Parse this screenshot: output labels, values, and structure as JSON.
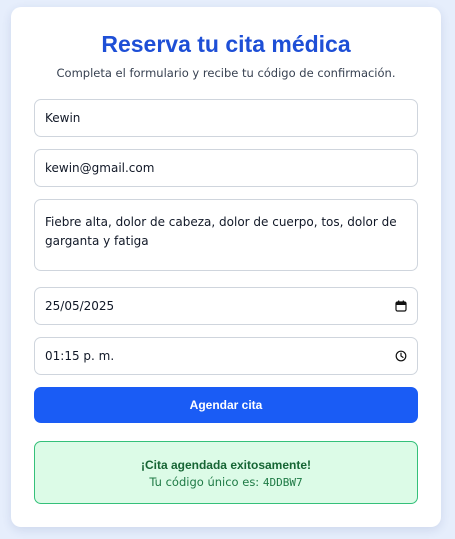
{
  "form": {
    "title": "Reserva tu cita médica",
    "subtitle": "Completa el formulario y recibe tu código de confirmación.",
    "name_value": "Kewin",
    "email_value": "kewin@gmail.com",
    "symptoms_value": "Fiebre alta, dolor de cabeza, dolor de cuerpo, tos, dolor de garganta y fatiga",
    "date_value": "25/05/2025",
    "time_value": "01:15 p. m.",
    "date_icon": "calendar-icon",
    "time_icon": "clock-icon",
    "submit_label": "Agendar cita"
  },
  "confirmation": {
    "title": "¡Cita agendada exitosamente!",
    "code_prefix": "Tu código único es:",
    "code": "4DDBW7"
  },
  "colors": {
    "accent": "#1a5cf5",
    "title": "#1e4fd6",
    "success_bg": "#dcfbe7",
    "success_border": "#34c07a"
  }
}
